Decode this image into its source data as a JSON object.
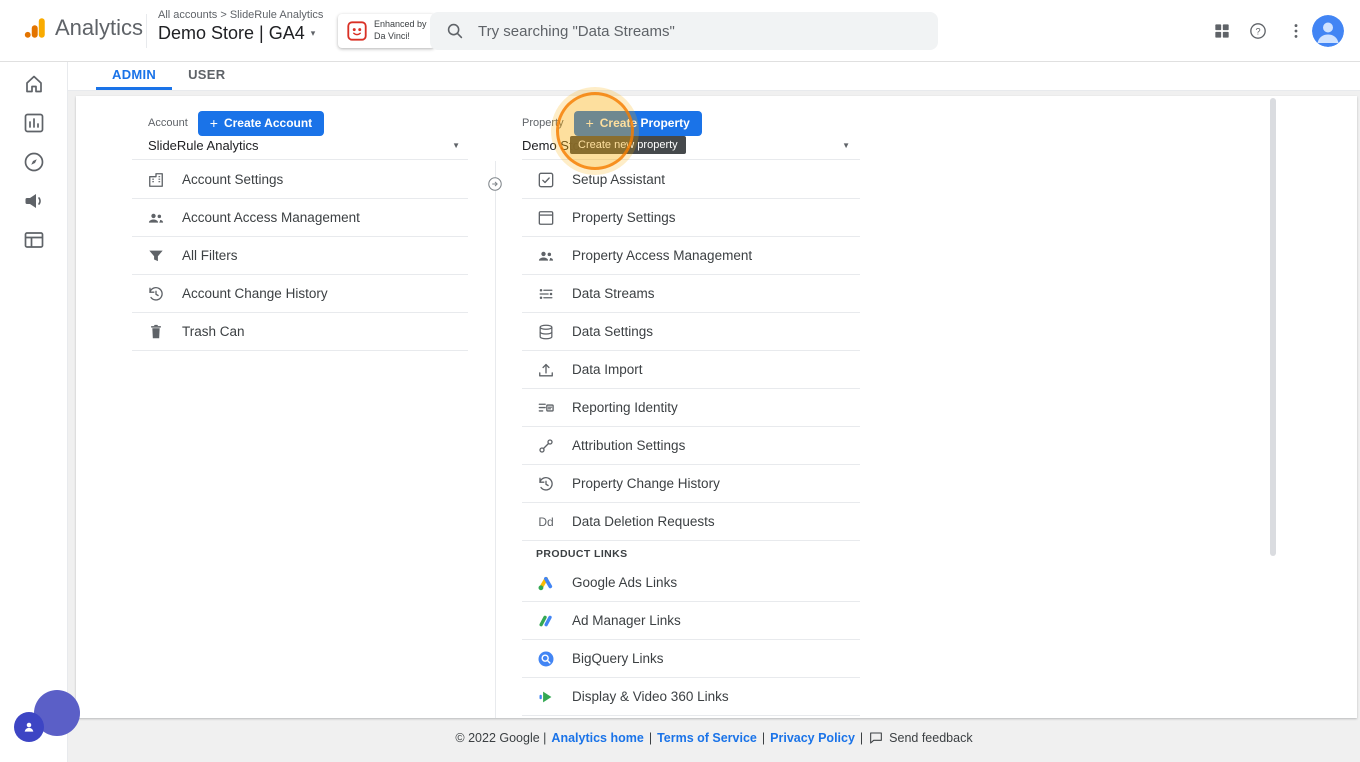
{
  "colors": {
    "accent_blue": "#1a73e8",
    "highlight_orange": "#f57c00",
    "logo_orange": "#f9ab00",
    "logo_dark_orange": "#e37400",
    "tooltip_bg": "#3c4043"
  },
  "header": {
    "app_name": "Analytics",
    "breadcrumb": "All accounts > SlideRule Analytics",
    "account_selector": "Demo Store | GA4",
    "enhanced_badge_line1": "Enhanced by",
    "enhanced_badge_line2": "Da Vinci!",
    "search_placeholder": "Try searching \"Data Streams\""
  },
  "tabs": {
    "admin": "ADMIN",
    "user": "USER"
  },
  "sidebar": {
    "items": [
      "home-icon",
      "reports-icon",
      "explore-icon",
      "advertising-icon",
      "admin-icon"
    ]
  },
  "account": {
    "label": "Account",
    "create_button": "Create Account",
    "selected": "SlideRule Analytics",
    "items": [
      {
        "label": "Account Settings",
        "icon": "building-icon"
      },
      {
        "label": "Account Access Management",
        "icon": "people-icon"
      },
      {
        "label": "All Filters",
        "icon": "filter-icon"
      },
      {
        "label": "Account Change History",
        "icon": "history-icon"
      },
      {
        "label": "Trash Can",
        "icon": "trash-icon"
      }
    ]
  },
  "property": {
    "label": "Property",
    "create_button": "Create Property",
    "tooltip": "Create new property",
    "selected": "Demo Store",
    "items": [
      {
        "label": "Setup Assistant",
        "icon": "checklist-icon"
      },
      {
        "label": "Property Settings",
        "icon": "window-icon"
      },
      {
        "label": "Property Access Management",
        "icon": "people-icon"
      },
      {
        "label": "Data Streams",
        "icon": "streams-icon"
      },
      {
        "label": "Data Settings",
        "icon": "database-icon"
      },
      {
        "label": "Data Import",
        "icon": "upload-icon"
      },
      {
        "label": "Reporting Identity",
        "icon": "identity-icon"
      },
      {
        "label": "Attribution Settings",
        "icon": "attribution-icon"
      },
      {
        "label": "Property Change History",
        "icon": "history-icon"
      },
      {
        "label": "Data Deletion Requests",
        "icon": "dd-icon",
        "icon_text": "Dd"
      }
    ],
    "product_links_header": "PRODUCT LINKS",
    "product_links": [
      {
        "label": "Google Ads Links",
        "icon": "google-ads-icon"
      },
      {
        "label": "Ad Manager Links",
        "icon": "ad-manager-icon"
      },
      {
        "label": "BigQuery Links",
        "icon": "bigquery-icon"
      },
      {
        "label": "Display & Video 360 Links",
        "icon": "dv360-icon"
      }
    ]
  },
  "footer": {
    "copyright": "© 2022 Google |",
    "links": [
      "Analytics home",
      "Terms of Service",
      "Privacy Policy"
    ],
    "separator": "|",
    "feedback": "Send feedback"
  }
}
